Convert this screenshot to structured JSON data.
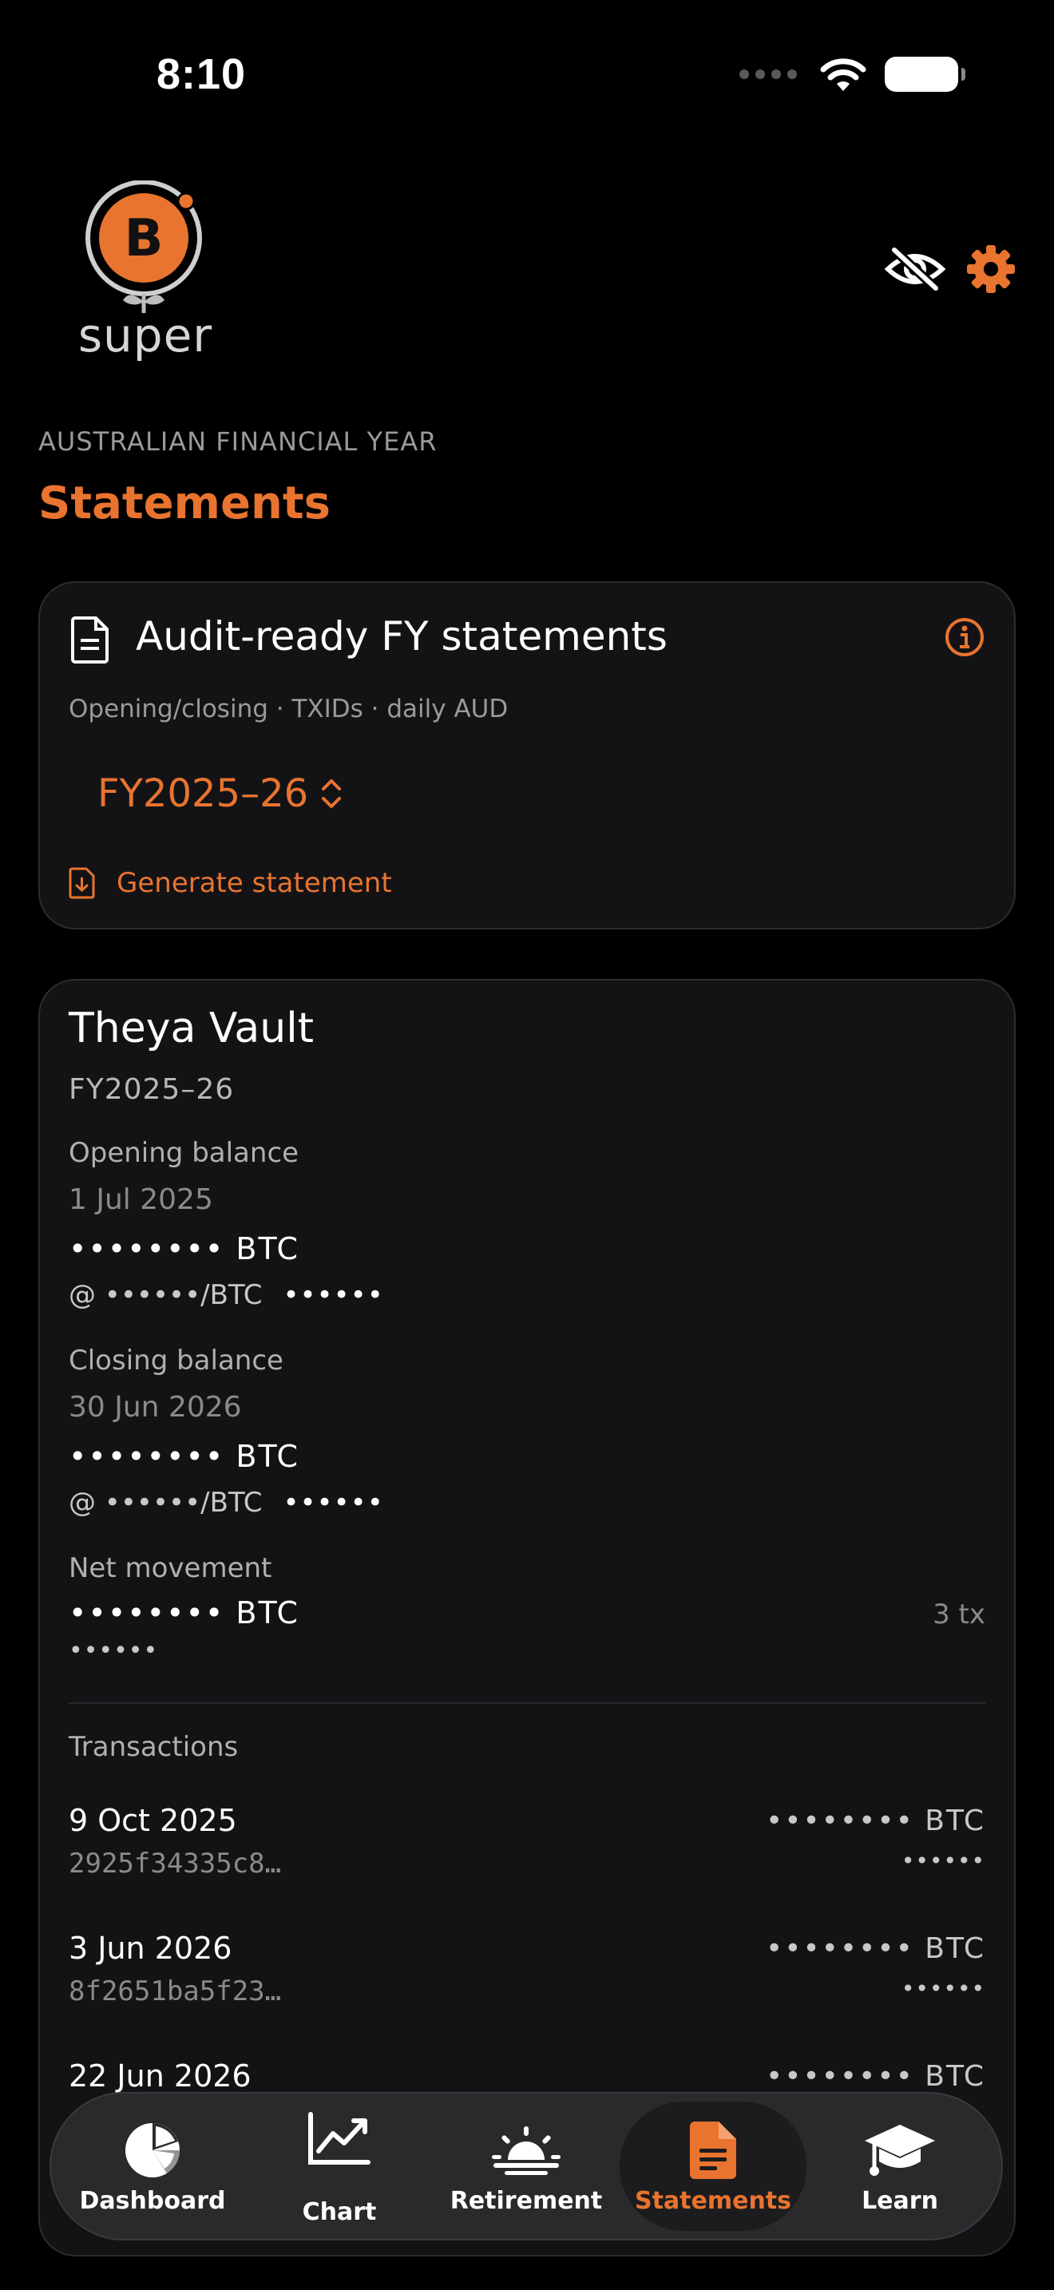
{
  "status_bar": {
    "time": "8:10"
  },
  "header": {
    "logo_text": "super",
    "eyebrow": "AUSTRALIAN FINANCIAL YEAR",
    "title": "Statements"
  },
  "audit_card": {
    "title": "Audit-ready FY statements",
    "subtitle": "Opening/closing · TXIDs · daily AUD",
    "fy_selected": "FY2025–26",
    "generate_label": "Generate statement"
  },
  "vault": {
    "name": "Theya Vault",
    "fy": "FY2025–26",
    "opening": {
      "label": "Opening balance",
      "date": "1 Jul 2025",
      "amount": "•••••••• BTC",
      "rate": "@ ••••••/BTC",
      "fiat": "••••••"
    },
    "closing": {
      "label": "Closing balance",
      "date": "30 Jun 2026",
      "amount": "•••••••• BTC",
      "rate": "@ ••••••/BTC",
      "fiat": "••••••"
    },
    "net": {
      "label": "Net movement",
      "amount": "•••••••• BTC",
      "fiat": "••••••",
      "tx_count": "3 tx"
    },
    "transactions_label": "Transactions",
    "transactions": [
      {
        "date": "9 Oct 2025",
        "txid": "2925f34335c8…",
        "amount": "•••••••• BTC",
        "fiat": "••••••"
      },
      {
        "date": "3 Jun 2026",
        "txid": "8f2651ba5f23…",
        "amount": "•••••••• BTC",
        "fiat": "••••••"
      },
      {
        "date": "22 Jun 2026",
        "txid": "",
        "amount": "•••••••• BTC",
        "fiat": ""
      }
    ]
  },
  "tabs": [
    {
      "label": "Dashboard",
      "icon": "pie-chart-icon"
    },
    {
      "label": "Chart",
      "icon": "line-chart-icon"
    },
    {
      "label": "Retirement",
      "icon": "sunrise-icon"
    },
    {
      "label": "Statements",
      "icon": "document-icon",
      "active": true
    },
    {
      "label": "Learn",
      "icon": "graduation-cap-icon"
    }
  ],
  "colors": {
    "accent": "#e8742f",
    "background": "#000000",
    "card": "#131316"
  }
}
